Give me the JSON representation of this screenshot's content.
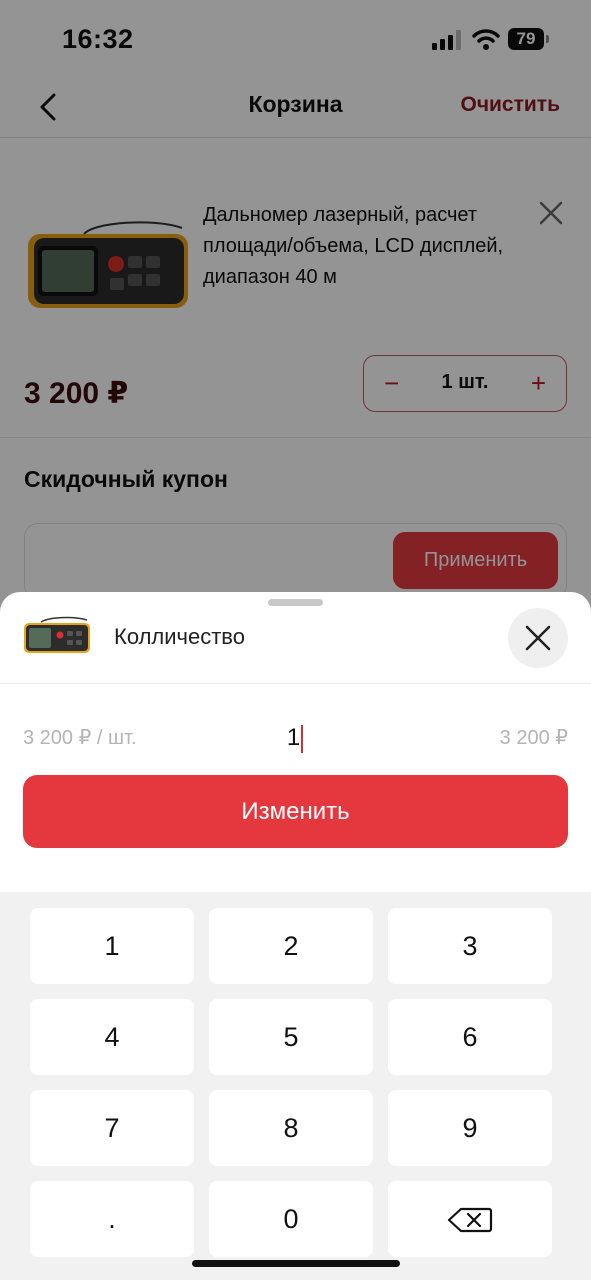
{
  "status_bar": {
    "time": "16:32",
    "battery": "79"
  },
  "nav": {
    "title": "Корзина",
    "clear_label": "Очистить"
  },
  "product": {
    "name": "Дальномер лазерный, расчет площади/объема, LCD дисплей, диапазон 40 м",
    "price": "3 200 ₽",
    "quantity": "1 шт.",
    "minus": "−",
    "plus": "+"
  },
  "coupon": {
    "title": "Скидочный купон",
    "apply_label": "Применить"
  },
  "sheet": {
    "title": "Колличество",
    "unit_price": "3 200 ₽ / шт.",
    "qty_value": "1",
    "total_price": "3 200 ₽",
    "change_label": "Изменить"
  },
  "keypad": {
    "keys": [
      "1",
      "2",
      "3",
      "4",
      "5",
      "6",
      "7",
      "8",
      "9",
      ".",
      "0"
    ]
  },
  "colors": {
    "accent": "#e5383e",
    "dark_accent": "#8b1a1f",
    "price": "#3b0b0e"
  },
  "icons": [
    "back-icon",
    "close-icon",
    "backspace-icon",
    "signal-icon",
    "wifi-icon",
    "battery-icon"
  ]
}
